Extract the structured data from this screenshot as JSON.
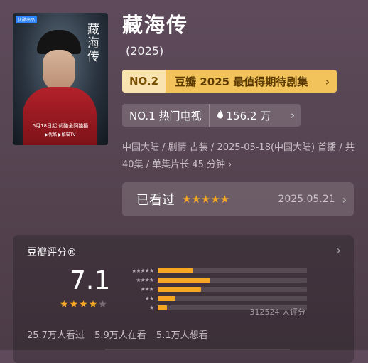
{
  "poster": {
    "platform_badge": "优酷出品",
    "vertical_title": "藏海传",
    "date_line": "5月18日起 优酷全网独播",
    "platforms": "▶优酷  ▶酷喵TV"
  },
  "show": {
    "title": "藏海传",
    "year": "(2025)"
  },
  "rank": {
    "number": "NO.2",
    "text": "豆瓣 2025 最值得期待剧集",
    "chevron": "›"
  },
  "hot": {
    "label": "NO.1 热门电视",
    "flame_icon": "flame-icon",
    "count": "156.2 万",
    "chevron": "›"
  },
  "meta": {
    "text": "中国大陆 / 剧情 古装 / 2025-05-18(中国大陆) 首播 / 共40集 / 单集片长 45 分钟 ›"
  },
  "watched": {
    "label": "已看过",
    "stars": "★★★★★",
    "date": "2025.05.21",
    "chevron": "›"
  },
  "rating": {
    "title": "豆瓣评分®",
    "chevron": "›",
    "score": "7.1",
    "star_full_1": "★",
    "star_full_2": "★",
    "star_full_3": "★",
    "star_half": "★",
    "star_empty": "★",
    "distribution": [
      {
        "stars": "★★★★★",
        "fraction": 0.24
      },
      {
        "stars": "★★★★",
        "fraction": 0.35
      },
      {
        "stars": "★★★",
        "fraction": 0.29
      },
      {
        "stars": "★★",
        "fraction": 0.12
      },
      {
        "stars": "★",
        "fraction": 0.06
      }
    ],
    "count": "312524 人评分",
    "stats": {
      "watched": "25.7万人看过",
      "watching": "5.9万人在看",
      "want": "5.1万人想看"
    }
  },
  "colors": {
    "accent": "#f5a623",
    "rank_bg": "#f3c35b"
  }
}
